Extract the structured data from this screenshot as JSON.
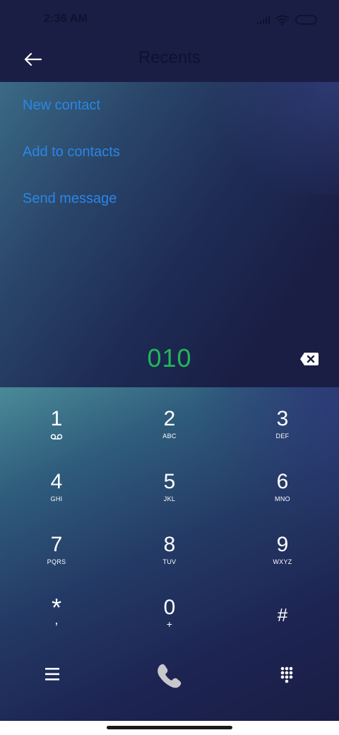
{
  "status_bar": {
    "time": "2:36 AM"
  },
  "app_bar": {
    "title": "Recents"
  },
  "menu": {
    "items": [
      {
        "label": "New contact"
      },
      {
        "label": "Add to contacts"
      },
      {
        "label": "Send message"
      }
    ]
  },
  "dialer": {
    "number": "010",
    "keys": [
      {
        "digit": "1",
        "letters": "",
        "sub_icon": "voicemail-icon"
      },
      {
        "digit": "2",
        "letters": "ABC"
      },
      {
        "digit": "3",
        "letters": "DEF"
      },
      {
        "digit": "4",
        "letters": "GHI"
      },
      {
        "digit": "5",
        "letters": "JKL"
      },
      {
        "digit": "6",
        "letters": "MNO"
      },
      {
        "digit": "7",
        "letters": "PQRS"
      },
      {
        "digit": "8",
        "letters": "TUV"
      },
      {
        "digit": "9",
        "letters": "WXYZ"
      },
      {
        "digit": "*",
        "letters": ","
      },
      {
        "digit": "0",
        "letters": "+"
      },
      {
        "digit": "#",
        "letters": ""
      }
    ]
  },
  "icons": {
    "back": "arrow-left-icon",
    "backspace": "backspace-icon",
    "menu": "hamburger-menu-icon",
    "call": "phone-icon",
    "keypad": "dialpad-icon",
    "signal": "signal-icon",
    "wifi": "wifi-icon",
    "battery": "battery-icon"
  },
  "colors": {
    "background": "#1a1e45",
    "link": "#2a86e6",
    "number": "#1fb85a",
    "key_text": "#ffffff",
    "call_button": "#c8c8cc"
  }
}
